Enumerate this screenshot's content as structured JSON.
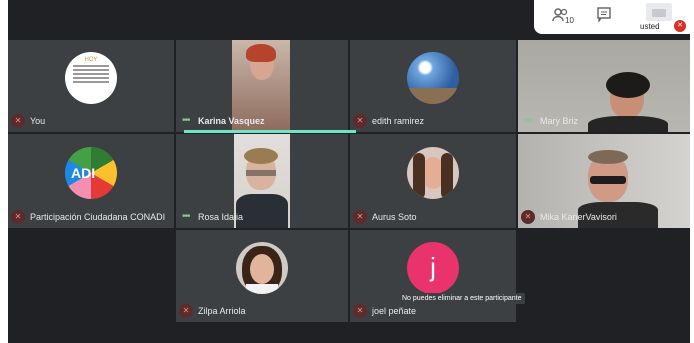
{
  "topbar": {
    "participants_count": "10",
    "self_label": "usted"
  },
  "participants": [
    {
      "id": "you",
      "name": "You",
      "muted": true
    },
    {
      "id": "karina",
      "name": "Karina Vasquez",
      "speaking": true
    },
    {
      "id": "edith",
      "name": "edith ramirez",
      "muted": true
    },
    {
      "id": "mary",
      "name": "Mary Briz",
      "speaking": true
    },
    {
      "id": "conadi",
      "name": "Participación Ciudadana CONADI",
      "muted": true
    },
    {
      "id": "rosa",
      "name": "Rosa Idalia",
      "speaking": true
    },
    {
      "id": "aurus",
      "name": "Aurus Soto",
      "muted": true
    },
    {
      "id": "mika",
      "name": "Mika KanerVavisori",
      "muted": true
    },
    {
      "id": "zilpa",
      "name": "Zilpa Arriola",
      "muted": true
    },
    {
      "id": "joel",
      "name": "joel peñate",
      "muted": true,
      "initial": "j"
    }
  ],
  "you_card": {
    "heading": "HOY"
  },
  "conadi_logo": {
    "text": "ADI"
  },
  "toast": "No puedes eliminar a este participante",
  "colors": {
    "background": "#202124",
    "tile": "#3c4043",
    "speaking": "#6ee6c6",
    "avatar_joel": "#e8336d"
  }
}
